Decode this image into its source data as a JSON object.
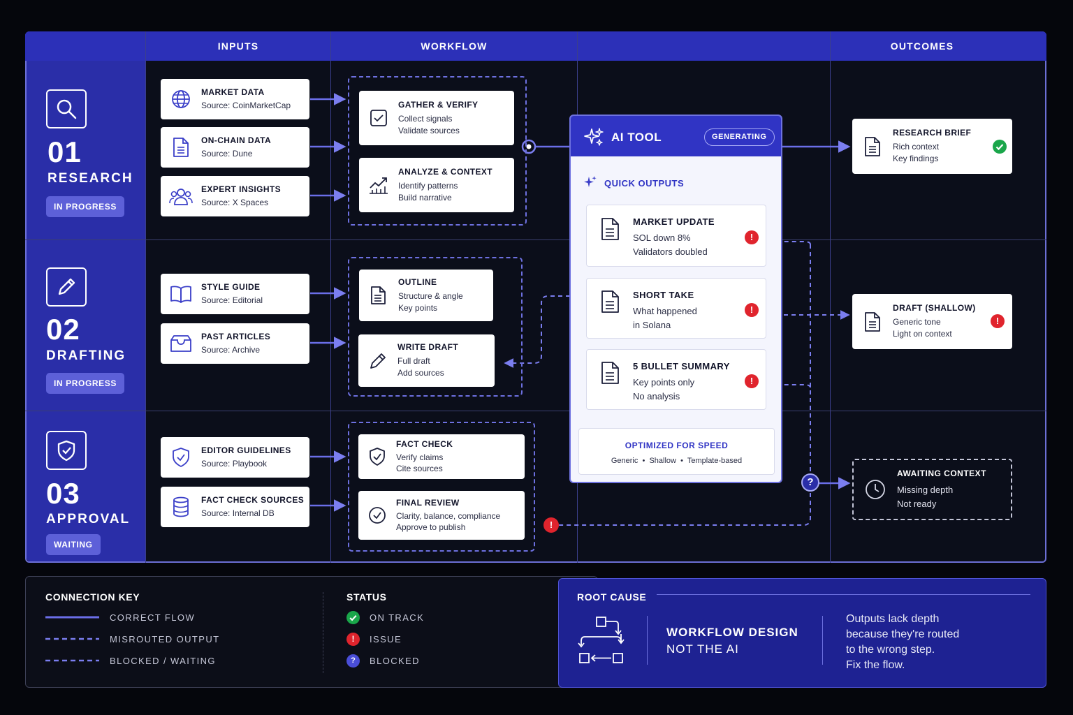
{
  "columns": {
    "inputs": "INPUTS",
    "workflow": "WORKFLOW",
    "outcomes": "OUTCOMES"
  },
  "stages": [
    {
      "num": "01",
      "name": "RESEARCH",
      "status": "IN PROGRESS",
      "icon": "search-icon"
    },
    {
      "num": "02",
      "name": "DRAFTING",
      "status": "IN PROGRESS",
      "icon": "pencil-icon"
    },
    {
      "num": "03",
      "name": "APPROVAL",
      "status": "WAITING",
      "icon": "shield-check-icon"
    }
  ],
  "inputs": [
    {
      "title": "MARKET DATA",
      "source": "Source: CoinMarketCap",
      "icon": "globe-icon"
    },
    {
      "title": "ON-CHAIN DATA",
      "source": "Source: Dune",
      "icon": "document-icon"
    },
    {
      "title": "EXPERT INSIGHTS",
      "source": "Source: X Spaces",
      "icon": "users-icon"
    },
    {
      "title": "STYLE GUIDE",
      "source": "Source: Editorial",
      "icon": "book-icon"
    },
    {
      "title": "PAST ARTICLES",
      "source": "Source: Archive",
      "icon": "archive-icon"
    },
    {
      "title": "EDITOR GUIDELINES",
      "source": "Source: Playbook",
      "icon": "shield-check-icon"
    },
    {
      "title": "FACT CHECK SOURCES",
      "source": "Source: Internal DB",
      "icon": "database-icon"
    }
  ],
  "workflow": [
    {
      "title": "GATHER & VERIFY",
      "l1": "Collect signals",
      "l2": "Validate sources",
      "icon": "checkbox-icon"
    },
    {
      "title": "ANALYZE & CONTEXT",
      "l1": "Identify patterns",
      "l2": "Build narrative",
      "icon": "trend-chart-icon"
    },
    {
      "title": "OUTLINE",
      "l1": "Structure & angle",
      "l2": "Key points",
      "icon": "document-icon"
    },
    {
      "title": "WRITE DRAFT",
      "l1": "Full draft",
      "l2": "Add sources",
      "icon": "pencil-icon"
    },
    {
      "title": "FACT CHECK",
      "l1": "Verify claims",
      "l2": "Cite sources",
      "icon": "shield-check-icon"
    },
    {
      "title": "FINAL REVIEW",
      "l1": "Clarity, balance, compliance",
      "l2": "Approve to publish",
      "icon": "check-circle-icon"
    }
  ],
  "ai_tool": {
    "title": "AI TOOL",
    "badge": "GENERATING",
    "quick_outputs_label": "QUICK OUTPUTS",
    "outputs": [
      {
        "title": "MARKET UPDATE",
        "l1": "SOL down 8%",
        "l2": "Validators doubled"
      },
      {
        "title": "SHORT TAKE",
        "l1": "What happened",
        "l2": "in Solana"
      },
      {
        "title": "5 BULLET SUMMARY",
        "l1": "Key points only",
        "l2": "No analysis"
      }
    ],
    "optimized_title": "OPTIMIZED FOR SPEED",
    "optimized_tags": "Generic  •  Shallow  •  Template-based"
  },
  "outcomes": [
    {
      "title": "RESEARCH BRIEF",
      "l1": "Rich context",
      "l2": "Key findings",
      "status": "on-track"
    },
    {
      "title": "DRAFT (SHALLOW)",
      "l1": "Generic tone",
      "l2": "Light on context",
      "status": "issue"
    },
    {
      "title": "AWAITING CONTEXT",
      "l1": "Missing depth",
      "l2": "Not ready",
      "status": "blocked"
    }
  ],
  "legend": {
    "connection_key": "CONNECTION KEY",
    "correct": "CORRECT FLOW",
    "misrouted": "MISROUTED OUTPUT",
    "blocked": "BLOCKED / WAITING",
    "status_title": "STATUS",
    "on_track": "ON TRACK",
    "issue": "ISSUE",
    "blocked_status": "BLOCKED"
  },
  "root_cause": {
    "label": "ROOT CAUSE",
    "headline_1": "WORKFLOW DESIGN",
    "headline_2": "NOT THE AI",
    "desc_1": "Outputs lack depth",
    "desc_2": "because they're routed",
    "desc_3": "to the wrong step.",
    "desc_4": "Fix the flow."
  },
  "colors": {
    "accent": "#3034c4",
    "issue": "#e0242d",
    "ok": "#1aa64a",
    "blocked": "#4a4ed8"
  }
}
